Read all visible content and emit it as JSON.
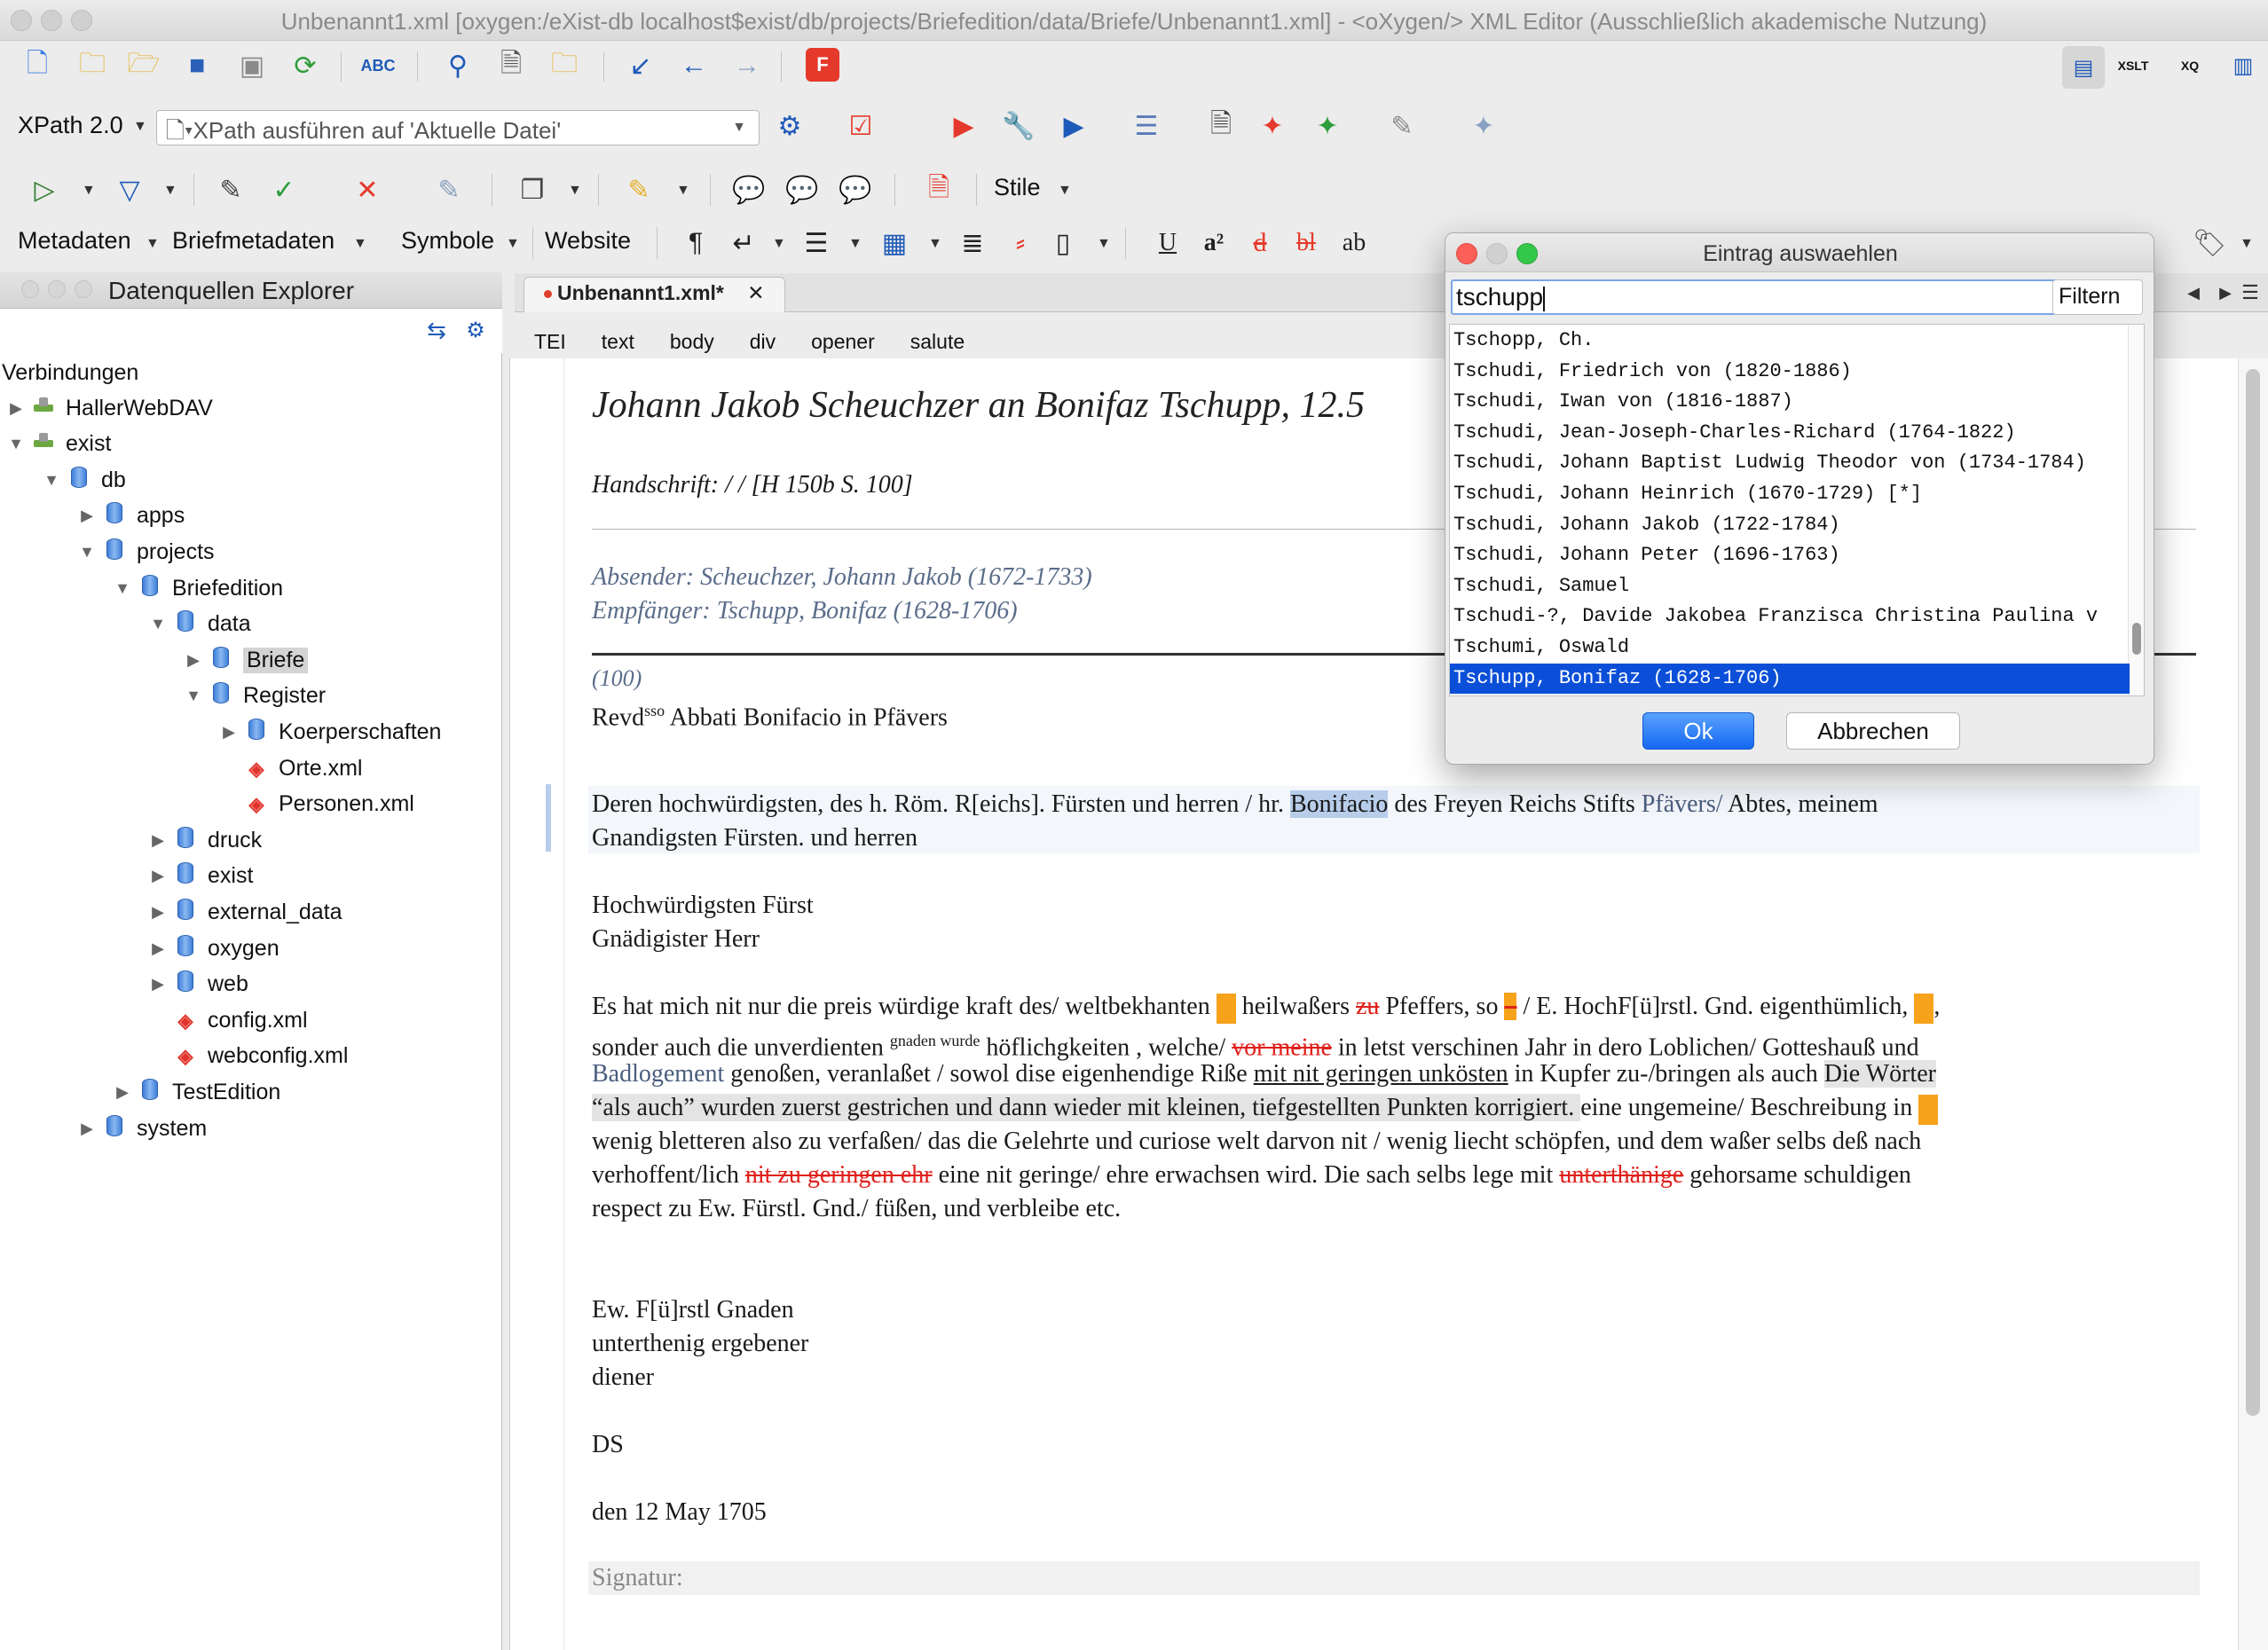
{
  "window": {
    "title": "Unbenannt1.xml [oxygen:/eXist-db localhost$exist/db/projects/Briefedition/data/Briefe/Unbenannt1.xml] - <oXygen/> XML Editor (Ausschließlich akademische Nutzung)"
  },
  "toolbar": {
    "xpath_version": "XPath 2.0",
    "xpath_placeholder": "XPath ausführen auf  'Aktuelle Datei'",
    "stile_label": "Stile",
    "menu_metadaten": "Metadaten",
    "menu_briefmetadaten": "Briefmetadaten",
    "menu_symbole": "Symbole",
    "menu_website": "Website",
    "fmt_underline": "U",
    "fmt_sup": "a²",
    "fmt_del1": "d",
    "fmt_del2": "bl",
    "fmt_ab": "ab",
    "icons": [
      "new-file-icon",
      "open-folder-icon",
      "open-url-icon",
      "save-icon",
      "save-all-icon",
      "reload-icon",
      "spellcheck-icon",
      "find-icon",
      "find-in-files-icon",
      "open-file-icon",
      "go-to-icon",
      "back-arrow-icon",
      "forward-arrow-icon",
      "fop-icon"
    ],
    "spellcheck_label": "ABC",
    "xslt_label": "XSLT",
    "xq_label": "XQ"
  },
  "explorer": {
    "title": "Datenquellen Explorer",
    "root_label": "Verbindungen",
    "items": [
      {
        "label": "HallerWebDAV",
        "indent": 0,
        "arrow": "right",
        "icon": "connection"
      },
      {
        "label": "exist",
        "indent": 0,
        "arrow": "down",
        "icon": "connection"
      },
      {
        "label": "db",
        "indent": 1,
        "arrow": "down",
        "icon": "db"
      },
      {
        "label": "apps",
        "indent": 2,
        "arrow": "right",
        "icon": "db"
      },
      {
        "label": "projects",
        "indent": 2,
        "arrow": "down",
        "icon": "db"
      },
      {
        "label": "Briefedition",
        "indent": 3,
        "arrow": "down",
        "icon": "db"
      },
      {
        "label": "data",
        "indent": 4,
        "arrow": "down",
        "icon": "db"
      },
      {
        "label": "Briefe",
        "indent": 5,
        "arrow": "right",
        "icon": "db",
        "selected": true
      },
      {
        "label": "Register",
        "indent": 5,
        "arrow": "down",
        "icon": "db"
      },
      {
        "label": "Koerperschaften",
        "indent": 6,
        "arrow": "right",
        "icon": "db"
      },
      {
        "label": "Orte.xml",
        "indent": 6,
        "arrow": "",
        "icon": "xml"
      },
      {
        "label": "Personen.xml",
        "indent": 6,
        "arrow": "",
        "icon": "xml"
      },
      {
        "label": "druck",
        "indent": 4,
        "arrow": "right",
        "icon": "db"
      },
      {
        "label": "exist",
        "indent": 4,
        "arrow": "right",
        "icon": "db"
      },
      {
        "label": "external_data",
        "indent": 4,
        "arrow": "right",
        "icon": "db"
      },
      {
        "label": "oxygen",
        "indent": 4,
        "arrow": "right",
        "icon": "db"
      },
      {
        "label": "web",
        "indent": 4,
        "arrow": "right",
        "icon": "db"
      },
      {
        "label": "config.xml",
        "indent": 4,
        "arrow": "",
        "icon": "xml"
      },
      {
        "label": "webconfig.xml",
        "indent": 4,
        "arrow": "",
        "icon": "xml"
      },
      {
        "label": "TestEdition",
        "indent": 3,
        "arrow": "right",
        "icon": "db"
      },
      {
        "label": "system",
        "indent": 2,
        "arrow": "right",
        "icon": "db"
      }
    ]
  },
  "editor": {
    "tab_label": "Unbenannt1.xml*",
    "tab_close": "✕",
    "breadcrumb": [
      "TEI",
      "text",
      "body",
      "div",
      "opener",
      "salute"
    ],
    "title_line": "Johann Jakob Scheuchzer an Bonifaz Tschupp, 12.5",
    "handschrift": "Handschrift:  /  / [H 150b S. 100]",
    "absender": "Absender: Scheuchzer, Johann Jakob (1672-1733)",
    "empfaenger": "Empfänger: Tschupp, Bonifaz (1628-1706)",
    "page_ref": "(100)",
    "address_a": "Revd",
    "address_sup": "sso",
    "address_b": " Abbati Bonifacio in Pfävers",
    "para1_a": "Deren hochwürdigsten, des h. Röm. R[eichs]. Fürsten und herren / hr. ",
    "para1_sel": "Bonifacio",
    "para1_b": " des Freyen Reichs Stifts ",
    "para1_ref": "Pfävers/",
    "para1_c": " Abtes, meinem",
    "para1_line2": "Gnandigsten Fürsten. und herren",
    "salute1": "Hochwürdigsten Fürst",
    "salute2": "Gnädigister Herr",
    "body1_a": "Es hat mich nit nur die preis würdige kraft des/ weltbekhanten ",
    "body1_b": " heilwaßers ",
    "body1_strike1": "zu",
    "body1_c": " Pfeffers, so ",
    "body1_strike2": "–",
    "body1_d": " / E. HochF[ü]rstl. Gnd. eigenthümlich, ",
    "body1_e": ",",
    "body2_a": "sonder auch die unverdienten ",
    "body2_sup": "gnaden wurde",
    "body2_b": " höflichgkeiten , welche/ ",
    "body2_strike": "vor meine",
    "body2_c": " in letst verschinen Jahr in dero Loblichen/ Gotteshauß und",
    "body3_ref": "Badlogement",
    "body3_a": " genoßen, veranlaßet / sowol dise eigenhendige Riße ",
    "body3_under": "mit nit geringen unkösten",
    "body3_b": " in Kupfer zu-/bringen als auch ",
    "body3_note": "Die Wörter",
    "body4_note": "“als auch” wurden zuerst gestrichen und dann wieder mit kleinen, tiefgestellten Punkten korrigiert. ",
    "body4_a": " eine ungemeine/ Beschreibung in ",
    "body5": "wenig bletteren also zu verfaßen/ das die Gelehrte und curiose welt darvon nit / wenig liecht schöpfen, und dem waßer selbs deß nach",
    "body6_a": "verhoffent/lich ",
    "body6_strike1": "nit zu geringen ehr",
    "body6_b": " eine nit geringe/ ehre erwachsen wird. Die sach selbs lege mit ",
    "body6_strike2": "unterthänige",
    "body6_c": " gehorsame schuldigen",
    "body7": "respect zu Ew. Fürstl. Gnd./ füßen, und verbleibe etc.",
    "closing1": "Ew. F[ü]rstl Gnaden",
    "closing2": "unterthenig ergebener",
    "closing3": "diener",
    "ds": "DS",
    "date": "den 12 May 1705",
    "signatur": "Signatur:"
  },
  "dialog": {
    "title": "Eintrag auswaehlen",
    "search_value": "tschupp",
    "filter_label": "Filtern",
    "items": [
      "Tschopp, Ch.",
      "Tschudi, Friedrich von (1820-1886)",
      "Tschudi, Iwan von (1816-1887)",
      "Tschudi, Jean-Joseph-Charles-Richard (1764-1822)",
      "Tschudi, Johann Baptist Ludwig Theodor von (1734-1784)",
      "Tschudi, Johann Heinrich (1670-1729) [*]",
      "Tschudi, Johann Jakob (1722-1784)",
      "Tschudi, Johann Peter (1696-1763)",
      "Tschudi, Samuel",
      "Tschudi-?, Davide Jakobea Franzisca Christina Paulina v",
      "Tschumi, Oswald",
      "Tschupp, Bonifaz (1628-1706)"
    ],
    "selected_index": 11,
    "ok_label": "Ok",
    "cancel_label": "Abbrechen"
  },
  "colors": {
    "selection": "#0b4fd8",
    "strike": "#e0201b",
    "marker": "#f7a21b",
    "meta": "#5b6d8a"
  }
}
